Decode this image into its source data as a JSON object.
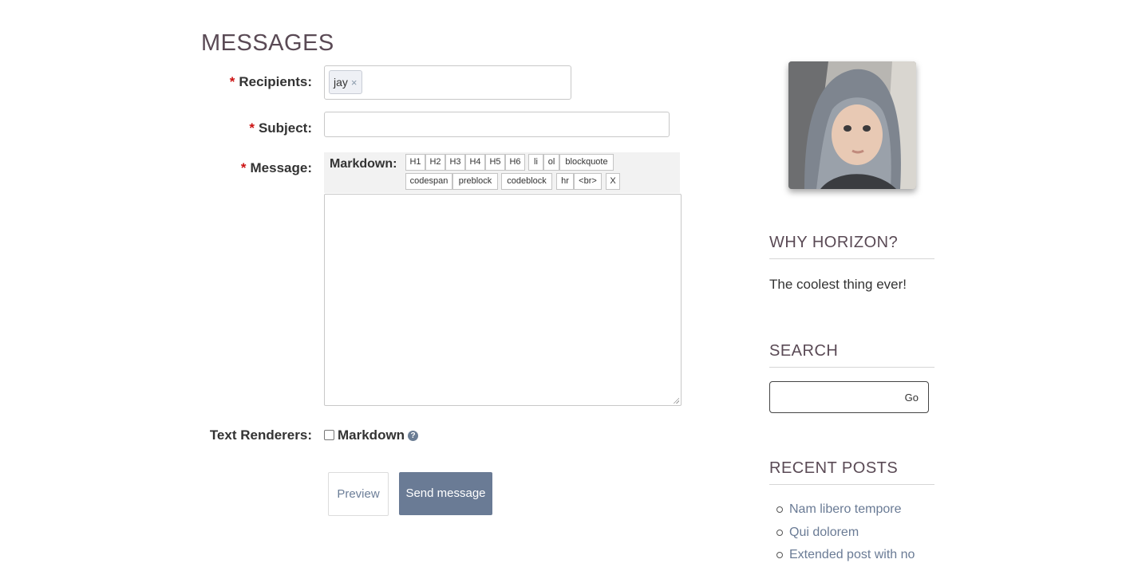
{
  "page": {
    "title": "MESSAGES"
  },
  "form": {
    "recipients_label": "Recipients:",
    "recipients_token": "jay",
    "token_remove": "×",
    "subject_label": "Subject:",
    "subject_value": "",
    "message_label": "Message:",
    "required_mark": "*",
    "message_value": ""
  },
  "toolbar": {
    "label": "Markdown:",
    "buttons": [
      "H1",
      "H2",
      "H3",
      "H4",
      "H5",
      "H6",
      "li",
      "ol",
      "blockquote",
      "codespan",
      "preblock",
      "codeblock",
      "hr",
      "<br>",
      "X"
    ]
  },
  "renderers": {
    "label": "Text Renderers:",
    "option": "Markdown",
    "checked": false,
    "help_icon": "question-circle-icon",
    "help_glyph": "?"
  },
  "actions": {
    "preview": "Preview",
    "send": "Send message"
  },
  "sidebar": {
    "why_title": "WHY HORIZON?",
    "why_text": "The coolest thing ever!",
    "search_title": "SEARCH",
    "search_value": "",
    "search_button": "Go",
    "recent_title": "RECENT POSTS",
    "recent_posts": [
      "Nam libero tempore",
      "Qui dolorem",
      "Extended post with no"
    ]
  },
  "colors": {
    "accent": "#6a7b95",
    "required": "#cc1111",
    "heading": "#5a4a55"
  }
}
